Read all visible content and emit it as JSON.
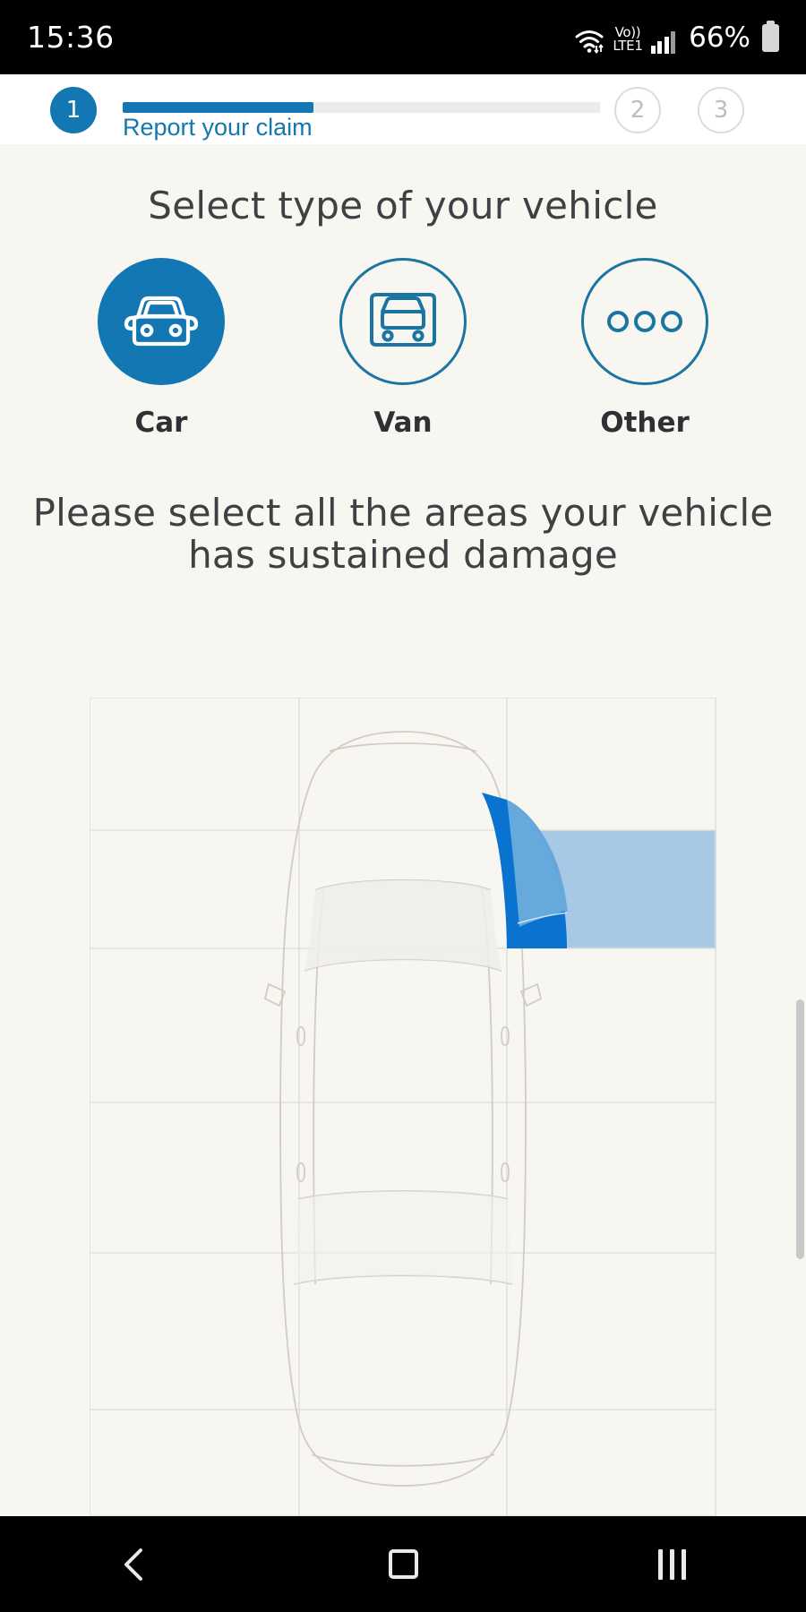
{
  "statusbar": {
    "time": "15:36",
    "volte_top": "Vo))",
    "volte_bottom": "LTE1",
    "battery_percent": "66%",
    "wifi_icon": "wifi-icon",
    "signal_icon": "signal-bars-icon",
    "battery_icon": "battery-icon"
  },
  "stepper": {
    "step1_number": "1",
    "step2_number": "2",
    "step3_number": "3",
    "current_label": "Report your claim",
    "progress_percent": 40,
    "active_color": "#1277b2",
    "track_color": "#ececec",
    "label_color": "#1278ad"
  },
  "main": {
    "heading_vehicle_type": "Select type of your vehicle",
    "heading_damage": "Please select all the areas your vehicle has sustained damage",
    "vehicle_types": [
      {
        "id": "car",
        "label": "Car",
        "icon": "car-front-icon",
        "selected": true
      },
      {
        "id": "van",
        "label": "Van",
        "icon": "van-front-icon",
        "selected": false
      },
      {
        "id": "other",
        "label": "Other",
        "icon": "ellipsis-icon",
        "selected": false
      }
    ],
    "accent_color": "#1277b2",
    "outline_color": "#1b75a2",
    "background_color": "#f7f6f1"
  },
  "damage_diagram": {
    "view": "top-down car",
    "grid_columns": 3,
    "grid_rows": 5,
    "grid_line_color": "#e2e0da",
    "car_outline_color": "#cfcdc6",
    "selected_regions": [
      {
        "id": "front-right-fender",
        "label": "Front right",
        "fill": "#0a72cf",
        "state": "selected"
      },
      {
        "id": "front-right-quarter-overlay",
        "label": "Front right overlay",
        "fill": "#65a9dd",
        "state": "selected"
      },
      {
        "id": "right-side-cell",
        "label": "Right front cell",
        "fill": "#a8c9e5",
        "state": "selected"
      }
    ],
    "unselected_fill": "#f7f6f1"
  },
  "navbar": {
    "back_label": "back-icon",
    "home_label": "home-icon",
    "recents_label": "recents-icon"
  }
}
